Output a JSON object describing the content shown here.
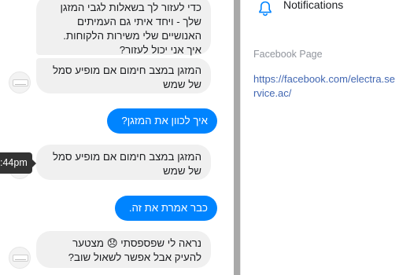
{
  "messages": {
    "m1": "כדי לעזור לך בשאלות לגבי המזגן שלך - ויחד איתי גם העמיתים האנושיים שלי משירות הלקוחות. איך אני יכול לעזור?",
    "m2": "המזגן במצב חימום אם מופיע סמל של שמש",
    "m3": "איך לכוון את המזגן?",
    "m4": "המזגן במצב חימום אם מופיע סמל של שמש",
    "m5": "כבר אמרת את זה.",
    "m6_before": "נראה לי שפספסתי ",
    "m6_emoji": "😞",
    "m6_after": " מצטער להעיק אבל אפשר לשאול שוב?"
  },
  "tooltip": ":44pm",
  "sidebar": {
    "notifications": "Notifications",
    "facebook_page_label": "Facebook Page",
    "facebook_page_url": "https://facebook.com/electra.service.ac/"
  },
  "colors": {
    "outgoing": "#0084ff",
    "incoming": "#f0f0f0",
    "link": "#4267b2"
  }
}
